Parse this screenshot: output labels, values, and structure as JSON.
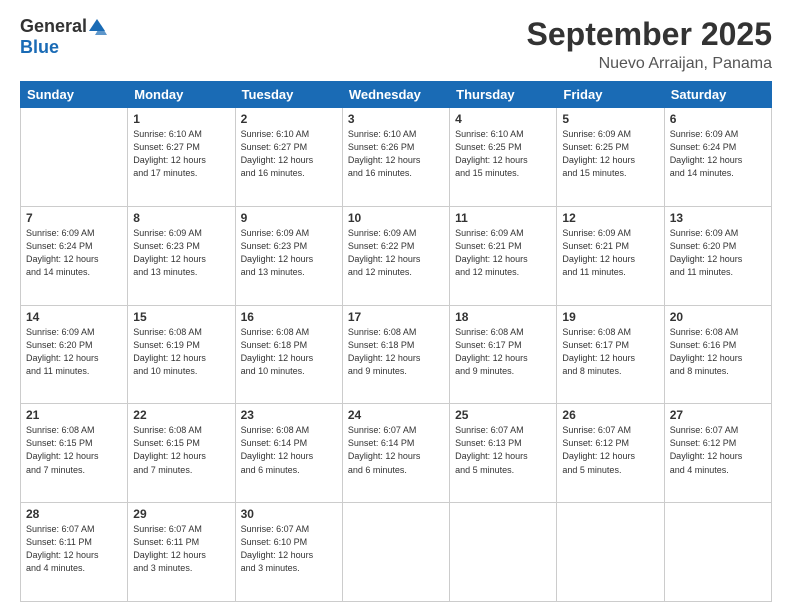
{
  "header": {
    "logo_general": "General",
    "logo_blue": "Blue",
    "month": "September 2025",
    "location": "Nuevo Arraijan, Panama"
  },
  "weekdays": [
    "Sunday",
    "Monday",
    "Tuesday",
    "Wednesday",
    "Thursday",
    "Friday",
    "Saturday"
  ],
  "weeks": [
    [
      {
        "day": "",
        "info": ""
      },
      {
        "day": "1",
        "info": "Sunrise: 6:10 AM\nSunset: 6:27 PM\nDaylight: 12 hours\nand 17 minutes."
      },
      {
        "day": "2",
        "info": "Sunrise: 6:10 AM\nSunset: 6:27 PM\nDaylight: 12 hours\nand 16 minutes."
      },
      {
        "day": "3",
        "info": "Sunrise: 6:10 AM\nSunset: 6:26 PM\nDaylight: 12 hours\nand 16 minutes."
      },
      {
        "day": "4",
        "info": "Sunrise: 6:10 AM\nSunset: 6:25 PM\nDaylight: 12 hours\nand 15 minutes."
      },
      {
        "day": "5",
        "info": "Sunrise: 6:09 AM\nSunset: 6:25 PM\nDaylight: 12 hours\nand 15 minutes."
      },
      {
        "day": "6",
        "info": "Sunrise: 6:09 AM\nSunset: 6:24 PM\nDaylight: 12 hours\nand 14 minutes."
      }
    ],
    [
      {
        "day": "7",
        "info": "Sunrise: 6:09 AM\nSunset: 6:24 PM\nDaylight: 12 hours\nand 14 minutes."
      },
      {
        "day": "8",
        "info": "Sunrise: 6:09 AM\nSunset: 6:23 PM\nDaylight: 12 hours\nand 13 minutes."
      },
      {
        "day": "9",
        "info": "Sunrise: 6:09 AM\nSunset: 6:23 PM\nDaylight: 12 hours\nand 13 minutes."
      },
      {
        "day": "10",
        "info": "Sunrise: 6:09 AM\nSunset: 6:22 PM\nDaylight: 12 hours\nand 12 minutes."
      },
      {
        "day": "11",
        "info": "Sunrise: 6:09 AM\nSunset: 6:21 PM\nDaylight: 12 hours\nand 12 minutes."
      },
      {
        "day": "12",
        "info": "Sunrise: 6:09 AM\nSunset: 6:21 PM\nDaylight: 12 hours\nand 11 minutes."
      },
      {
        "day": "13",
        "info": "Sunrise: 6:09 AM\nSunset: 6:20 PM\nDaylight: 12 hours\nand 11 minutes."
      }
    ],
    [
      {
        "day": "14",
        "info": "Sunrise: 6:09 AM\nSunset: 6:20 PM\nDaylight: 12 hours\nand 11 minutes."
      },
      {
        "day": "15",
        "info": "Sunrise: 6:08 AM\nSunset: 6:19 PM\nDaylight: 12 hours\nand 10 minutes."
      },
      {
        "day": "16",
        "info": "Sunrise: 6:08 AM\nSunset: 6:18 PM\nDaylight: 12 hours\nand 10 minutes."
      },
      {
        "day": "17",
        "info": "Sunrise: 6:08 AM\nSunset: 6:18 PM\nDaylight: 12 hours\nand 9 minutes."
      },
      {
        "day": "18",
        "info": "Sunrise: 6:08 AM\nSunset: 6:17 PM\nDaylight: 12 hours\nand 9 minutes."
      },
      {
        "day": "19",
        "info": "Sunrise: 6:08 AM\nSunset: 6:17 PM\nDaylight: 12 hours\nand 8 minutes."
      },
      {
        "day": "20",
        "info": "Sunrise: 6:08 AM\nSunset: 6:16 PM\nDaylight: 12 hours\nand 8 minutes."
      }
    ],
    [
      {
        "day": "21",
        "info": "Sunrise: 6:08 AM\nSunset: 6:15 PM\nDaylight: 12 hours\nand 7 minutes."
      },
      {
        "day": "22",
        "info": "Sunrise: 6:08 AM\nSunset: 6:15 PM\nDaylight: 12 hours\nand 7 minutes."
      },
      {
        "day": "23",
        "info": "Sunrise: 6:08 AM\nSunset: 6:14 PM\nDaylight: 12 hours\nand 6 minutes."
      },
      {
        "day": "24",
        "info": "Sunrise: 6:07 AM\nSunset: 6:14 PM\nDaylight: 12 hours\nand 6 minutes."
      },
      {
        "day": "25",
        "info": "Sunrise: 6:07 AM\nSunset: 6:13 PM\nDaylight: 12 hours\nand 5 minutes."
      },
      {
        "day": "26",
        "info": "Sunrise: 6:07 AM\nSunset: 6:12 PM\nDaylight: 12 hours\nand 5 minutes."
      },
      {
        "day": "27",
        "info": "Sunrise: 6:07 AM\nSunset: 6:12 PM\nDaylight: 12 hours\nand 4 minutes."
      }
    ],
    [
      {
        "day": "28",
        "info": "Sunrise: 6:07 AM\nSunset: 6:11 PM\nDaylight: 12 hours\nand 4 minutes."
      },
      {
        "day": "29",
        "info": "Sunrise: 6:07 AM\nSunset: 6:11 PM\nDaylight: 12 hours\nand 3 minutes."
      },
      {
        "day": "30",
        "info": "Sunrise: 6:07 AM\nSunset: 6:10 PM\nDaylight: 12 hours\nand 3 minutes."
      },
      {
        "day": "",
        "info": ""
      },
      {
        "day": "",
        "info": ""
      },
      {
        "day": "",
        "info": ""
      },
      {
        "day": "",
        "info": ""
      }
    ]
  ]
}
